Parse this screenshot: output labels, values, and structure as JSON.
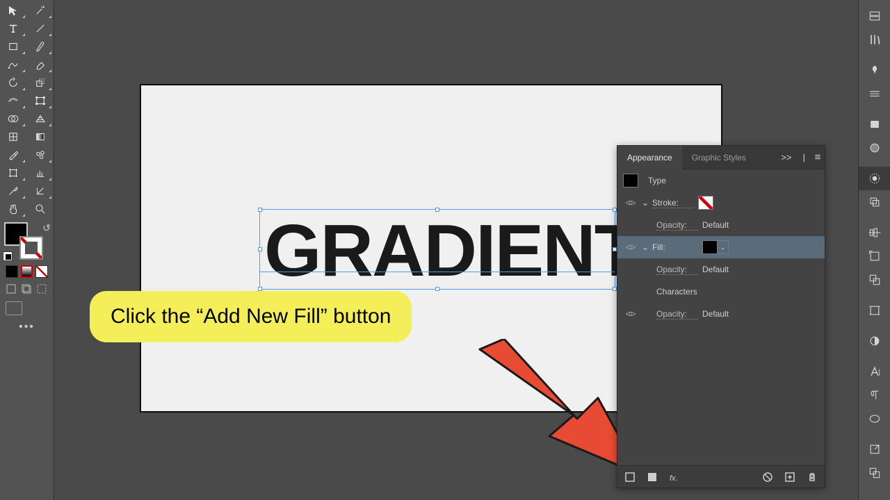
{
  "tools": {
    "items": [
      [
        "direct-selection-tool",
        "magic-wand-tool"
      ],
      [
        "type-tool",
        "line-segment-tool"
      ],
      [
        "rectangle-tool",
        "paintbrush-tool"
      ],
      [
        "shaper-tool",
        "eraser-tool"
      ],
      [
        "rotate-tool",
        "scale-tool"
      ],
      [
        "width-tool",
        "free-transform-tool"
      ],
      [
        "shape-builder-tool",
        "perspective-grid-tool"
      ],
      [
        "mesh-tool",
        "gradient-tool"
      ],
      [
        "eyedropper-tool",
        "symbol-sprayer-tool"
      ],
      [
        "column-graph-tool",
        "artboard-tool"
      ],
      [
        "slice-tool",
        "hand-tool-alt"
      ],
      [
        "hand-tool",
        "zoom-tool"
      ]
    ]
  },
  "dock": {
    "items": [
      "properties-icon",
      "libraries-icon",
      "symbols-icon",
      "paragraph-styles-icon",
      "color-icon",
      "color-guide-icon",
      "appearance-icon",
      "graphic-styles-icon",
      "align-icon",
      "transform-icon",
      "pathfinder-icon",
      "separator",
      "transparency-icon",
      "character-icon",
      "paragraph-icon",
      "glyphs-icon",
      "export-icon",
      "asset-export-icon"
    ]
  },
  "canvas": {
    "text": "GRADIENT"
  },
  "callout": {
    "text": "Click the “Add New Fill” button"
  },
  "panel": {
    "tabs": {
      "active": "Appearance",
      "other": "Graphic Styles",
      "collapse": ">>"
    },
    "type_label": "Type",
    "rows": {
      "stroke": {
        "label": "Stroke:"
      },
      "stroke_opacity": {
        "label": "Opacity:",
        "value": "Default"
      },
      "fill": {
        "label": "Fill:"
      },
      "fill_opacity": {
        "label": "Opacity:",
        "value": "Default"
      },
      "characters": {
        "label": "Characters"
      },
      "characters_opacity": {
        "label": "Opacity:",
        "value": "Default"
      }
    },
    "footer": {
      "buttons": [
        "add-new-stroke",
        "add-new-fill",
        "add-new-effect",
        "clear-appearance",
        "duplicate-item",
        "delete-item"
      ]
    }
  },
  "colors": {
    "selection": "#4f9de8",
    "callout": "#f4ef58",
    "arrow": "#e84b34"
  }
}
